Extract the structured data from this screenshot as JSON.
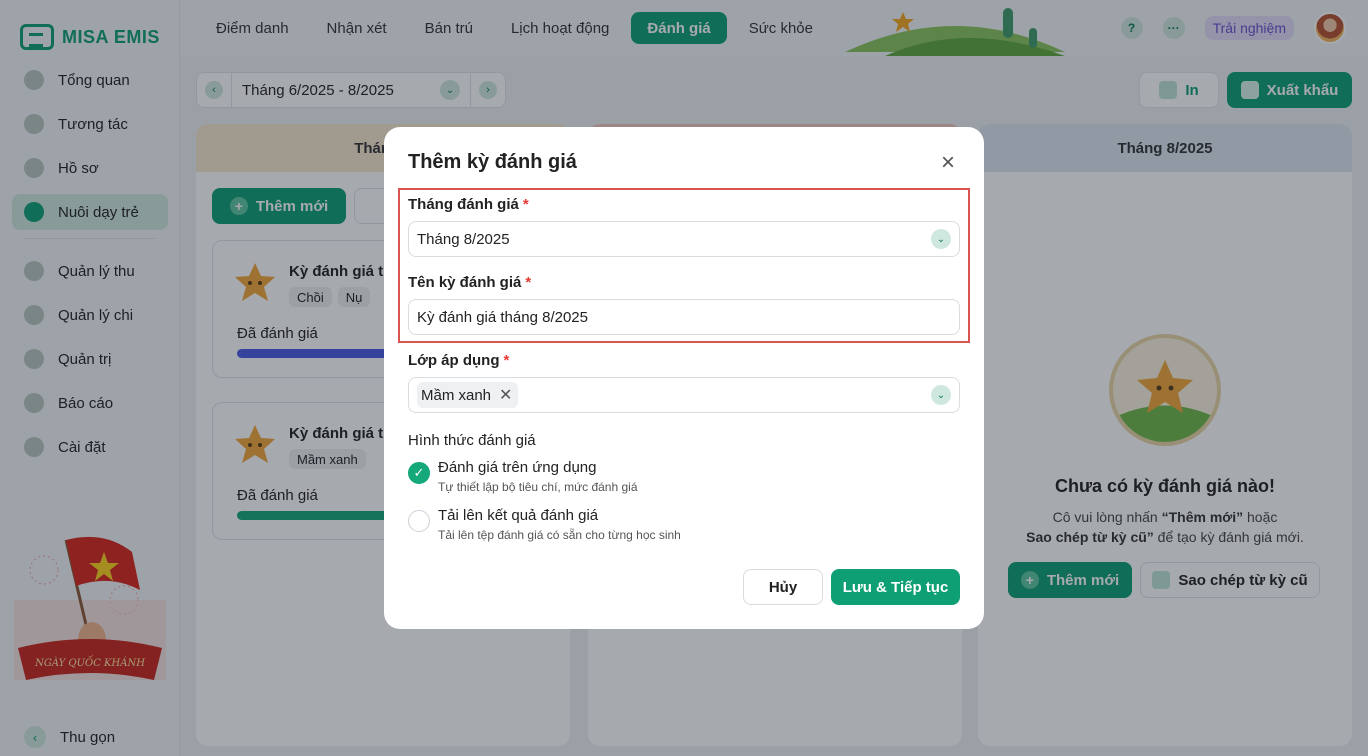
{
  "app": {
    "logo_text": "MISA EMIS"
  },
  "sidebar": {
    "items": [
      {
        "label": "Tổng quan",
        "icon": "pie-chart-icon"
      },
      {
        "label": "Tương tác",
        "icon": "send-icon"
      },
      {
        "label": "Hồ sơ",
        "icon": "folder-icon"
      },
      {
        "label": "Nuôi dạy trẻ",
        "icon": "heart-icon",
        "active": true
      },
      {
        "label": "Quản lý thu",
        "icon": "income-chart-icon"
      },
      {
        "label": "Quản lý chi",
        "icon": "wallet-icon"
      },
      {
        "label": "Quản trị",
        "icon": "briefcase-icon"
      },
      {
        "label": "Báo cáo",
        "icon": "bar-chart-icon"
      },
      {
        "label": "Cài đặt",
        "icon": "settings-icon"
      }
    ],
    "banner_text": "NGÀY QUỐC KHÁNH",
    "collapse_label": "Thu gọn"
  },
  "topbar": {
    "tabs": [
      "Điểm danh",
      "Nhận xét",
      "Bán trú",
      "Lịch hoạt động",
      "Đánh giá",
      "Sức khỏe"
    ],
    "active_tab": "Đánh giá",
    "help_glyph": "?",
    "more_glyph": "···",
    "trial_label": "Trải nghiệm"
  },
  "toolbar": {
    "period": "Tháng 6/2025 - 8/2025",
    "print_label": "In",
    "export_label": "Xuất khẩu"
  },
  "columns": [
    {
      "header": "Tháng 6",
      "add_label": "Thêm mới",
      "cards": [
        {
          "title": "Kỳ đánh giá th",
          "tags": [
            "Chồi",
            "Nụ"
          ],
          "status": "Đã đánh giá"
        },
        {
          "title": "Kỳ đánh giá th",
          "tags": [
            "Mầm xanh"
          ],
          "status": "Đã đánh giá"
        }
      ]
    },
    {
      "header": ""
    },
    {
      "header": "Tháng 8/2025",
      "empty": {
        "title": "Chưa có kỳ đánh giá nào!",
        "desc_pre": "Cô vui lòng nhấn ",
        "desc_bold1": "“Thêm mới”",
        "desc_mid": " hoặc",
        "desc_bold2": "Sao chép từ kỳ cũ”",
        "desc_post": " để tạo kỳ đánh giá mới.",
        "add_label": "Thêm mới",
        "copy_label": "Sao chép từ kỳ cũ"
      }
    }
  ],
  "modal": {
    "title": "Thêm kỳ đánh giá",
    "month_label": "Tháng đánh giá",
    "month_value": "Tháng 8/2025",
    "name_label": "Tên kỳ đánh giá",
    "name_value": "Kỳ đánh giá tháng 8/2025",
    "class_label": "Lớp áp dụng",
    "class_chip": "Mầm xanh",
    "required_mark": "*",
    "method_label": "Hình thức đánh giá",
    "options": [
      {
        "title": "Đánh giá trên ứng dụng",
        "sub": "Tự thiết lập bộ tiêu chí, mức đánh giá",
        "checked": true
      },
      {
        "title": "Tải lên kết quả đánh giá",
        "sub": "Tải lên tệp đánh giá có sẵn cho từng học sinh",
        "checked": false
      }
    ],
    "cancel_label": "Hủy",
    "save_label": "Lưu & Tiếp tục"
  },
  "colors": {
    "primary": "#0e9f74",
    "highlight": "#d9534f",
    "bar_blue": "#4b5be6"
  }
}
